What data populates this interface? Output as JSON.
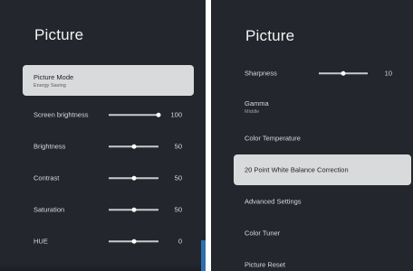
{
  "left": {
    "title": "Picture",
    "picture_mode": {
      "label": "Picture Mode",
      "value": "Energy Saving"
    },
    "sliders": [
      {
        "label": "Screen brightness",
        "value": "100",
        "fraction": 1.0
      },
      {
        "label": "Brightness",
        "value": "50",
        "fraction": 0.5
      },
      {
        "label": "Contrast",
        "value": "50",
        "fraction": 0.5
      },
      {
        "label": "Saturation",
        "value": "50",
        "fraction": 0.5
      },
      {
        "label": "HUE",
        "value": "0",
        "fraction": 0.5
      }
    ]
  },
  "right": {
    "title": "Picture",
    "sharpness": {
      "label": "Sharpness",
      "value": "10",
      "fraction": 0.5
    },
    "gamma": {
      "label": "Gamma",
      "value": "Middle"
    },
    "items": [
      {
        "label": "Color Temperature"
      },
      {
        "label": "20 Point White Balance Correction",
        "selected": true
      },
      {
        "label": "Advanced Settings"
      },
      {
        "label": "Color Tuner"
      },
      {
        "label": "Picture Reset"
      }
    ]
  },
  "colors": {
    "background": "#23272d",
    "selected_row": "#d9dadc",
    "accent_blue": "#2f6fb0"
  }
}
